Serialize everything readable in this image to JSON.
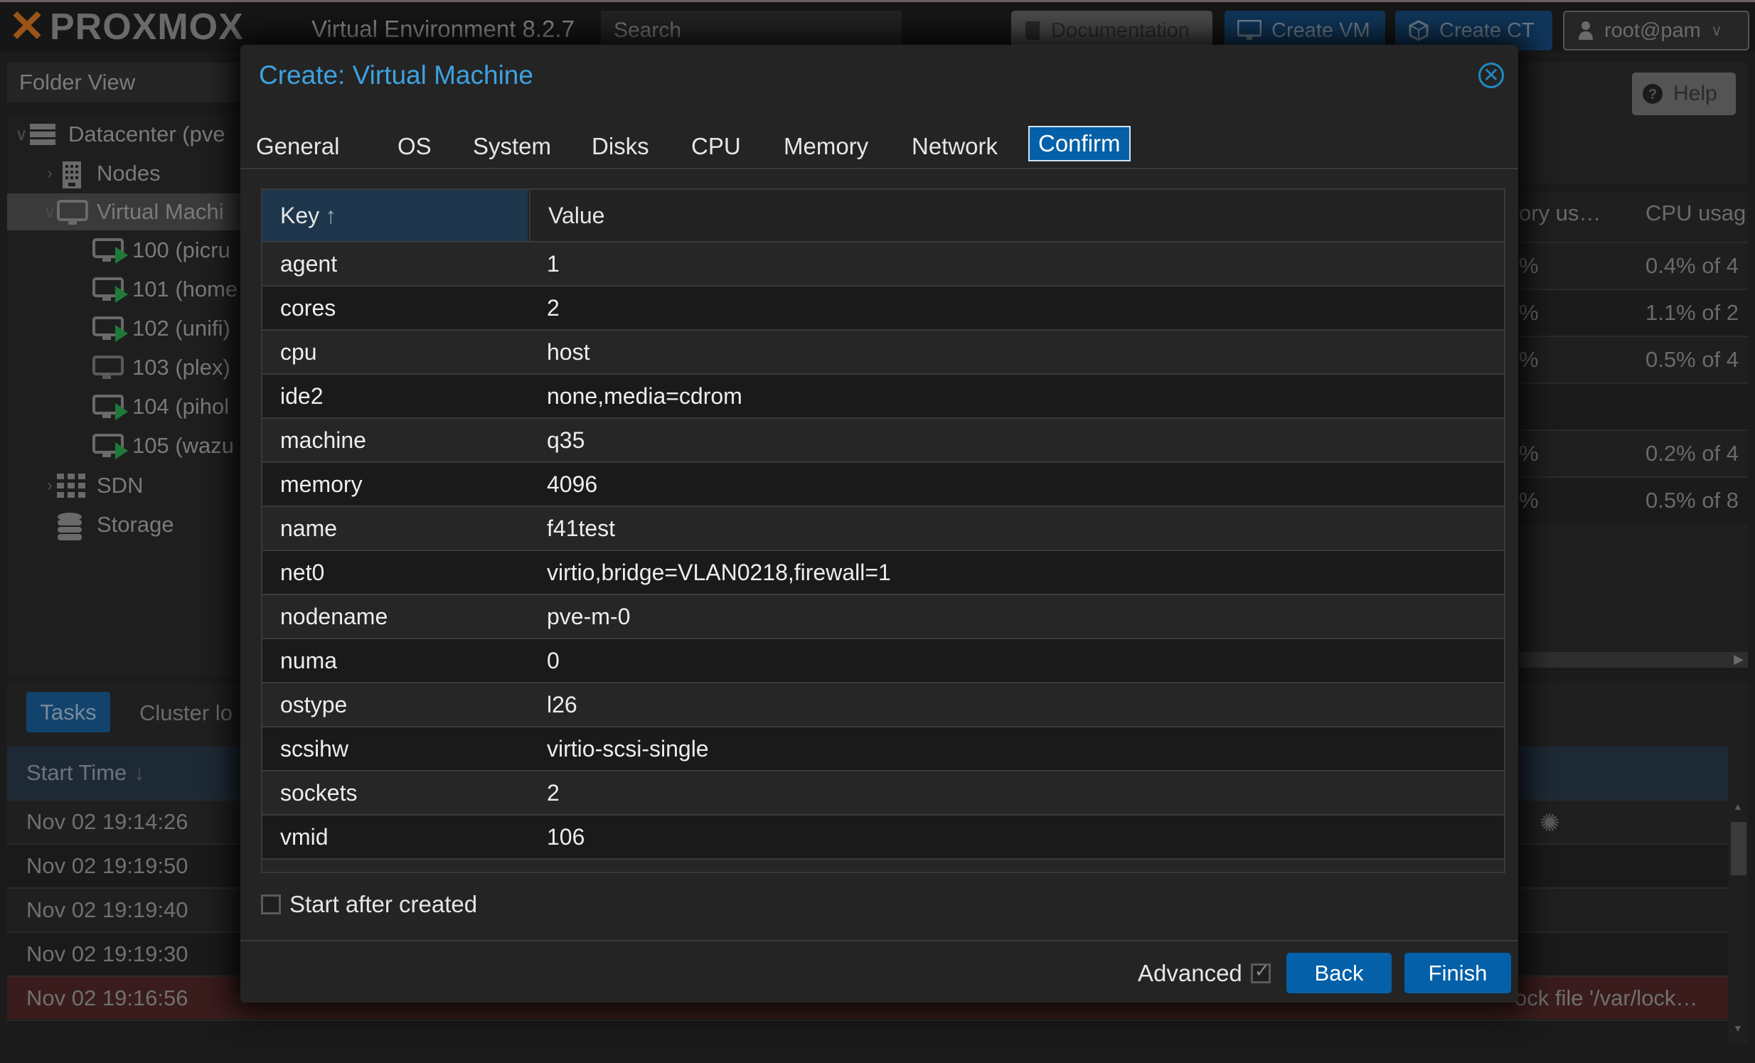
{
  "topbar": {
    "brand": "PROXMOX",
    "version": "Virtual Environment 8.2.7",
    "search_placeholder": "Search",
    "documentation_label": "Documentation",
    "create_vm_label": "Create VM",
    "create_ct_label": "Create CT",
    "user_label": "root@pam"
  },
  "sidebar": {
    "view_label": "Folder View",
    "tree": [
      {
        "label": "Datacenter (pve",
        "icon": "datacenter-icon",
        "expanded": true
      },
      {
        "label": "Nodes",
        "icon": "nodes-icon",
        "expanded": false
      },
      {
        "label": "Virtual Machi",
        "icon": "vm-group-icon",
        "expanded": true,
        "selected": true
      },
      {
        "label": "100 (picru",
        "icon": "vm-running-icon"
      },
      {
        "label": "101 (home",
        "icon": "vm-running-icon"
      },
      {
        "label": "102 (unifi)",
        "icon": "vm-running-icon"
      },
      {
        "label": "103 (plex)",
        "icon": "vm-stopped-icon"
      },
      {
        "label": "104 (pihol",
        "icon": "vm-running-icon"
      },
      {
        "label": "105 (wazu",
        "icon": "vm-running-icon"
      },
      {
        "label": "SDN",
        "icon": "sdn-icon",
        "expanded": false
      },
      {
        "label": "Storage",
        "icon": "storage-icon",
        "expanded": false
      }
    ]
  },
  "content_panel": {
    "help_label": "Help",
    "columns": [
      "ory us…",
      "CPU usag"
    ],
    "rows": [
      {
        "mem": "%",
        "cpu": "0.4% of 4"
      },
      {
        "mem": "%",
        "cpu": "1.1% of 2"
      },
      {
        "mem": "%",
        "cpu": "0.5% of 4"
      },
      {
        "mem": "",
        "cpu": ""
      },
      {
        "mem": "%",
        "cpu": "0.2% of 4"
      },
      {
        "mem": "%",
        "cpu": "0.5% of 8"
      }
    ]
  },
  "tasks": {
    "tabs": [
      "Tasks",
      "Cluster lo"
    ],
    "column_start_time": "Start Time",
    "rows": [
      {
        "start": "Nov 02 19:14:26",
        "status": ""
      },
      {
        "start": "Nov 02 19:19:50",
        "status": ""
      },
      {
        "start": "Nov 02 19:19:40",
        "status": ""
      },
      {
        "start": "Nov 02 19:19:30",
        "status": ""
      },
      {
        "start": "Nov 02 19:16:56",
        "status": "ock file '/var/lock…",
        "error": true
      }
    ]
  },
  "modal": {
    "title": "Create: Virtual Machine",
    "tabs": [
      "General",
      "OS",
      "System",
      "Disks",
      "CPU",
      "Memory",
      "Network",
      "Confirm"
    ],
    "active_tab": "Confirm",
    "table": {
      "key_header": "Key",
      "value_header": "Value",
      "rows": [
        {
          "key": "agent",
          "value": "1"
        },
        {
          "key": "cores",
          "value": "2"
        },
        {
          "key": "cpu",
          "value": "host"
        },
        {
          "key": "ide2",
          "value": "none,media=cdrom"
        },
        {
          "key": "machine",
          "value": "q35"
        },
        {
          "key": "memory",
          "value": "4096"
        },
        {
          "key": "name",
          "value": "f41test"
        },
        {
          "key": "net0",
          "value": "virtio,bridge=VLAN0218,firewall=1"
        },
        {
          "key": "nodename",
          "value": "pve-m-0"
        },
        {
          "key": "numa",
          "value": "0"
        },
        {
          "key": "ostype",
          "value": "l26"
        },
        {
          "key": "scsihw",
          "value": "virtio-scsi-single"
        },
        {
          "key": "sockets",
          "value": "2"
        },
        {
          "key": "vmid",
          "value": "106"
        }
      ]
    },
    "start_after_created_label": "Start after created",
    "start_after_created": false,
    "advanced_label": "Advanced",
    "advanced": true,
    "back_label": "Back",
    "finish_label": "Finish"
  },
  "colors": {
    "accent": "#0460a8",
    "title": "#3da2e0",
    "error_row": "#3a1c1c",
    "running": "#1f7a3a"
  }
}
